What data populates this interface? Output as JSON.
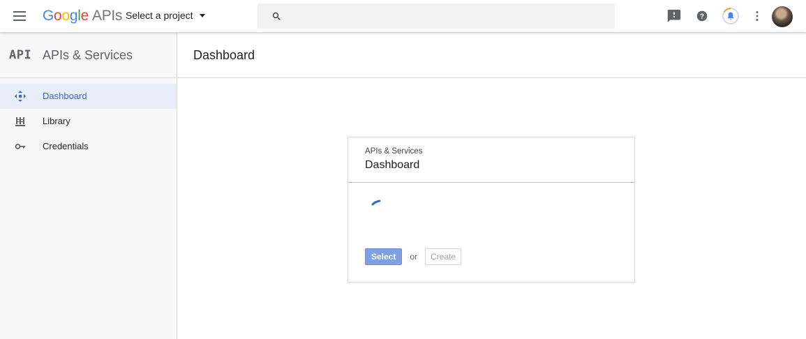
{
  "topbar": {
    "logo": {
      "g1": "G",
      "g2": "o",
      "g3": "o",
      "g4": "g",
      "g5": "l",
      "g6": "e",
      "suffix": "APIs"
    },
    "project_select": "Select a project",
    "search": {
      "value": "",
      "placeholder": ""
    },
    "icons": [
      "menu-icon",
      "search-icon",
      "feedback-icon",
      "help-icon",
      "notifications-icon",
      "more-vert-icon",
      "avatar"
    ]
  },
  "sidebar": {
    "logo_text": "API",
    "title": "APIs & Services",
    "items": [
      {
        "label": "Dashboard",
        "icon": "dashboard-icon",
        "active": true
      },
      {
        "label": "Library",
        "icon": "library-icon",
        "active": false
      },
      {
        "label": "Credentials",
        "icon": "key-icon",
        "active": false
      }
    ]
  },
  "main": {
    "title": "Dashboard",
    "card": {
      "subtitle": "APIs & Services",
      "title": "Dashboard",
      "select_label": "Select",
      "or_label": "or",
      "create_label": "Create"
    }
  },
  "colors": {
    "accent": "#3367d6",
    "active_bg": "#e8eef9",
    "select_button": "#7e9fe0",
    "google_blue": "#4285f4",
    "google_red": "#ea4335",
    "google_yellow": "#fbbc05",
    "google_green": "#34a853"
  }
}
